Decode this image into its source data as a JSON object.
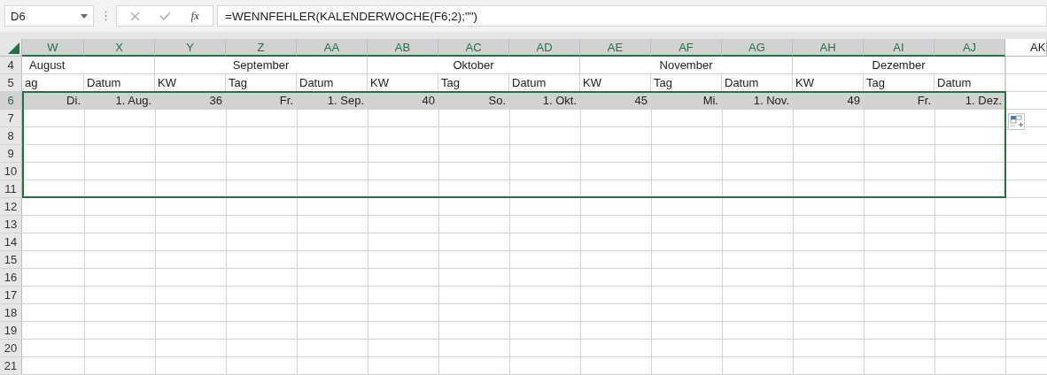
{
  "name_box": "D6",
  "function_label": "fx",
  "formula": "=WENNFEHLER(KALENDERWOCHE(F6;2);\"\")",
  "columns": [
    {
      "label": "W",
      "selected": true
    },
    {
      "label": "X",
      "selected": true
    },
    {
      "label": "Y",
      "selected": true
    },
    {
      "label": "Z",
      "selected": true
    },
    {
      "label": "AA",
      "selected": true
    },
    {
      "label": "AB",
      "selected": true
    },
    {
      "label": "AC",
      "selected": true
    },
    {
      "label": "AD",
      "selected": true
    },
    {
      "label": "AE",
      "selected": true
    },
    {
      "label": "AF",
      "selected": true
    },
    {
      "label": "AG",
      "selected": true
    },
    {
      "label": "AH",
      "selected": true
    },
    {
      "label": "AI",
      "selected": true
    },
    {
      "label": "AJ",
      "selected": true
    },
    {
      "label": "AK",
      "selected": false
    }
  ],
  "rows": [
    {
      "number": "4",
      "kind": "months",
      "selected": false,
      "in_selection": false,
      "cells": [
        "August",
        "September",
        "Oktober",
        "November",
        "Dezember"
      ]
    },
    {
      "number": "5",
      "kind": "labels",
      "selected": false,
      "in_selection": false,
      "cells": [
        "ag",
        "Datum",
        "KW",
        "Tag",
        "Datum",
        "KW",
        "Tag",
        "Datum",
        "KW",
        "Tag",
        "Datum",
        "KW",
        "Tag",
        "Datum"
      ]
    },
    {
      "number": "6",
      "kind": "values",
      "selected": true,
      "in_selection": true,
      "cells": [
        "Di.",
        "1. Aug.",
        "36",
        "Fr.",
        "1. Sep.",
        "40",
        "So.",
        "1. Okt.",
        "45",
        "Mi.",
        "1. Nov.",
        "49",
        "Fr.",
        "1. Dez."
      ]
    },
    {
      "number": "7",
      "kind": "empty",
      "selected": false,
      "in_selection": true
    },
    {
      "number": "8",
      "kind": "empty",
      "selected": false,
      "in_selection": true
    },
    {
      "number": "9",
      "kind": "empty",
      "selected": false,
      "in_selection": true
    },
    {
      "number": "10",
      "kind": "empty",
      "selected": false,
      "in_selection": true
    },
    {
      "number": "11",
      "kind": "empty",
      "selected": false,
      "in_selection": true
    },
    {
      "number": "12",
      "kind": "empty",
      "selected": false,
      "in_selection": false
    },
    {
      "number": "13",
      "kind": "empty",
      "selected": false,
      "in_selection": false
    },
    {
      "number": "14",
      "kind": "empty",
      "selected": false,
      "in_selection": false
    },
    {
      "number": "15",
      "kind": "empty",
      "selected": false,
      "in_selection": false
    },
    {
      "number": "16",
      "kind": "empty",
      "selected": false,
      "in_selection": false
    },
    {
      "number": "17",
      "kind": "empty",
      "selected": false,
      "in_selection": false
    },
    {
      "number": "18",
      "kind": "empty",
      "selected": false,
      "in_selection": false
    },
    {
      "number": "19",
      "kind": "empty",
      "selected": false,
      "in_selection": false
    },
    {
      "number": "20",
      "kind": "empty",
      "selected": false,
      "in_selection": false
    },
    {
      "number": "21",
      "kind": "empty",
      "selected": false,
      "in_selection": false
    }
  ]
}
